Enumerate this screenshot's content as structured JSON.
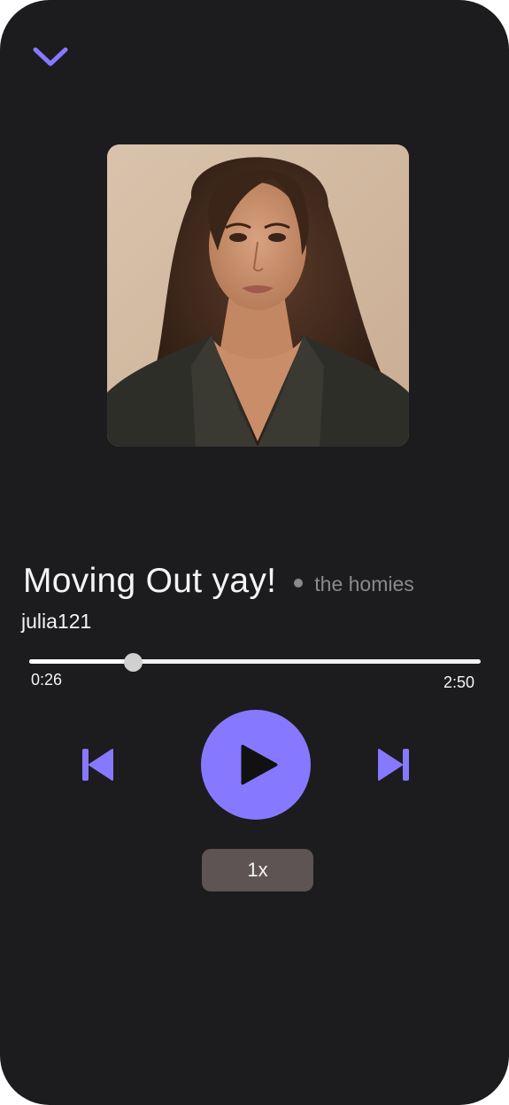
{
  "header": {
    "collapse_icon": "chevron-down-icon"
  },
  "player": {
    "album_art": "portrait-image",
    "title": "Moving Out yay!",
    "album": "the homies",
    "artist": "julia121",
    "progress_fraction": 0.23,
    "time_elapsed": "0:26",
    "time_total": "2:50",
    "speed": "1x"
  },
  "controls": {
    "previous_icon": "skip-previous-icon",
    "play_icon": "play-icon",
    "next_icon": "skip-next-icon"
  },
  "colors": {
    "background": "#1c1b1e",
    "accent": "#8679ff",
    "speed_button": "#5d5453",
    "text_primary": "#f4f4f4",
    "text_secondary": "#8a898c"
  }
}
